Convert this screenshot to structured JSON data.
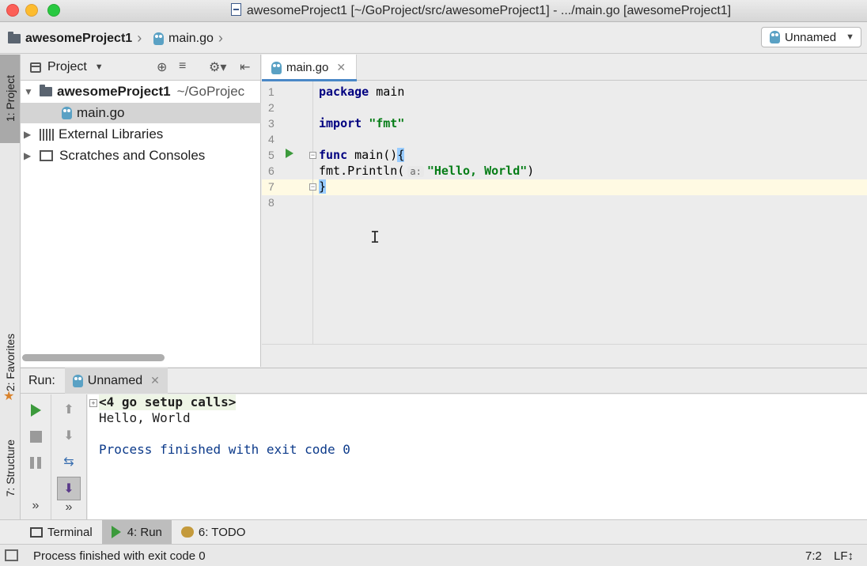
{
  "window": {
    "title": "awesomeProject1 [~/GoProject/src/awesomeProject1] - .../main.go [awesomeProject1]"
  },
  "navbar": {
    "project": "awesomeProject1",
    "file": "main.go",
    "run_config": "Unnamed"
  },
  "left_strip": {
    "project_tab": "1: Project",
    "favorites_tab": "2: Favorites",
    "structure_tab": "7: Structure"
  },
  "project_panel": {
    "header": "Project",
    "tree": [
      {
        "label": "awesomeProject1",
        "path": "~/GoProjec"
      },
      {
        "label": "main.go"
      },
      {
        "label": "External Libraries"
      },
      {
        "label": "Scratches and Consoles"
      }
    ]
  },
  "editor": {
    "tab": "main.go",
    "line_numbers": [
      "1",
      "2",
      "3",
      "4",
      "5",
      "6",
      "7",
      "8"
    ],
    "code": {
      "l1_kw": "package",
      "l1_rest": " main",
      "l3_kw": "import",
      "l3_str": "\"fmt\"",
      "l5_kw": "func",
      "l5_rest": " main()",
      "l5_brace": "{",
      "l6_call": "fmt.Println(",
      "l6_hint": "a:",
      "l6_str": "\"Hello, World\"",
      "l6_end": ")",
      "l7_brace": "}"
    }
  },
  "run_panel": {
    "label": "Run:",
    "tab": "Unnamed",
    "console": {
      "setup": "<4 go setup calls>",
      "output": "Hello, World",
      "exit": "Process finished with exit code 0"
    }
  },
  "tool_tabs": {
    "terminal": "Terminal",
    "run": "4: Run",
    "todo": "6: TODO"
  },
  "statusbar": {
    "message": "Process finished with exit code 0",
    "position": "7:2",
    "line_sep": "LF↕"
  },
  "colors": {
    "accent": "#4a88c7",
    "keyword": "#000080",
    "string": "#067d17",
    "run_green": "#3c9a3c"
  }
}
